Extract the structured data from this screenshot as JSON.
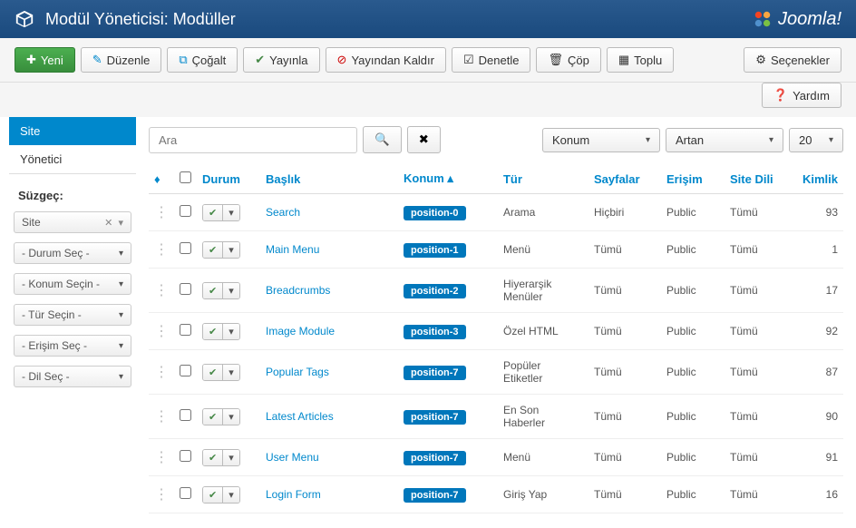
{
  "header": {
    "title": "Modül Yöneticisi: Modüller",
    "brand": "Joomla!"
  },
  "toolbar": {
    "new": "Yeni",
    "edit": "Düzenle",
    "duplicate": "Çoğalt",
    "publish": "Yayınla",
    "unpublish": "Yayından Kaldır",
    "checkin": "Denetle",
    "trash": "Çöp",
    "batch": "Toplu",
    "options": "Seçenekler",
    "help": "Yardım"
  },
  "sidebar": {
    "tabs": {
      "site": "Site",
      "admin": "Yönetici"
    },
    "filter_label": "Süzgeç:",
    "filters": {
      "site": "Site",
      "status": "- Durum Seç -",
      "position": "- Konum Seçin -",
      "type": "- Tür Seçin -",
      "access": "- Erişim Seç -",
      "language": "- Dil Seç -"
    }
  },
  "search": {
    "placeholder": "Ara",
    "sort_by": "Konum",
    "direction": "Artan",
    "limit": "20"
  },
  "columns": {
    "status": "Durum",
    "title": "Başlık",
    "position": "Konum",
    "type": "Tür",
    "pages": "Sayfalar",
    "access": "Erişim",
    "language": "Site Dili",
    "id": "Kimlik"
  },
  "rows": [
    {
      "title": "Search",
      "position": "position-0",
      "type": "Arama",
      "pages": "Hiçbiri",
      "access": "Public",
      "lang": "Tümü",
      "id": "93"
    },
    {
      "title": "Main Menu",
      "position": "position-1",
      "type": "Menü",
      "pages": "Tümü",
      "access": "Public",
      "lang": "Tümü",
      "id": "1"
    },
    {
      "title": "Breadcrumbs",
      "position": "position-2",
      "type": "Hiyerarşik Menüler",
      "pages": "Tümü",
      "access": "Public",
      "lang": "Tümü",
      "id": "17"
    },
    {
      "title": "Image Module",
      "position": "position-3",
      "type": "Özel HTML",
      "pages": "Tümü",
      "access": "Public",
      "lang": "Tümü",
      "id": "92"
    },
    {
      "title": "Popular Tags",
      "position": "position-7",
      "type": "Popüler Etiketler",
      "pages": "Tümü",
      "access": "Public",
      "lang": "Tümü",
      "id": "87"
    },
    {
      "title": "Latest Articles",
      "position": "position-7",
      "type": "En Son Haberler",
      "pages": "Tümü",
      "access": "Public",
      "lang": "Tümü",
      "id": "90"
    },
    {
      "title": "User Menu",
      "position": "position-7",
      "type": "Menü",
      "pages": "Tümü",
      "access": "Public",
      "lang": "Tümü",
      "id": "91"
    },
    {
      "title": "Login Form",
      "position": "position-7",
      "type": "Giriş Yap",
      "pages": "Tümü",
      "access": "Public",
      "lang": "Tümü",
      "id": "16"
    }
  ]
}
